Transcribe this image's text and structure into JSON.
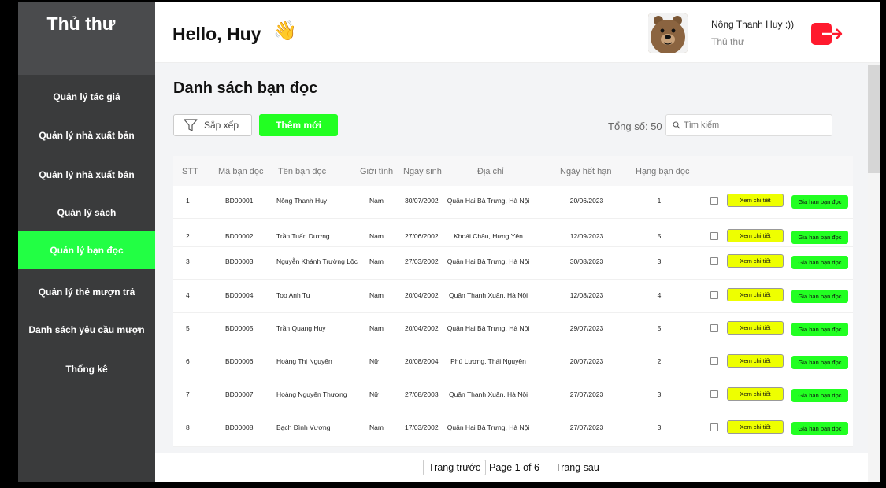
{
  "sidebar": {
    "title": "Thủ thư",
    "items": [
      {
        "label": "Quản lý tác giả",
        "active": false
      },
      {
        "label": "Quản lý nhà xuất bản",
        "active": false
      },
      {
        "label": "Quản lý nhà xuất bản",
        "active": false
      },
      {
        "label": "Quản lý sách",
        "active": false
      },
      {
        "label": "Quản lý bạn đọc",
        "active": true
      },
      {
        "label": "Quản lý thẻ mượn trả",
        "active": false
      },
      {
        "label": "Danh sách yêu cầu mượn",
        "active": false
      },
      {
        "label": "Thống kê",
        "active": false
      }
    ]
  },
  "header": {
    "greeting": "Hello, Huy",
    "wave": "👋",
    "user_name": "Nông Thanh Huy :))",
    "user_role": "Thủ thư"
  },
  "main": {
    "title": "Danh sách bạn đọc",
    "sort_label": "Sắp xếp",
    "add_label": "Thêm mới",
    "total_text": "Tổng số: 50",
    "search_placeholder": "Tìm kiếm"
  },
  "table": {
    "columns": [
      "STT",
      "Mã bạn đọc",
      "Tên bạn đọc",
      "Giới tính",
      "Ngày sinh",
      "Địa chỉ",
      "Ngày hết hạn",
      "Hạng bạn đọc"
    ],
    "view_label": "Xem chi tiết",
    "renew_label": "Gia hạn bạn đọc",
    "rows": [
      [
        "1",
        "BD00001",
        "Nông Thanh Huy",
        "Nam",
        "30/07/2002",
        "Quận Hai Bà Trưng, Hà Nội",
        "20/06/2023",
        "1"
      ],
      [
        "2",
        "BD00002",
        "Trần Tuấn Dương",
        "Nam",
        "27/06/2002",
        "Khoái Châu, Hưng Yên",
        "12/09/2023",
        "5"
      ],
      [
        "3",
        "BD00003",
        "Nguyễn Khánh Trường Lộc",
        "Nam",
        "27/03/2002",
        "Quận Hai Bà Trưng, Hà Nội",
        "30/08/2023",
        "3"
      ],
      [
        "4",
        "BD00004",
        "Too Anh Tu",
        "Nam",
        "20/04/2002",
        "Quận Thanh Xuân, Hà Nội",
        "12/08/2023",
        "4"
      ],
      [
        "5",
        "BD00005",
        "Trần Quang Huy",
        "Nam",
        "20/04/2002",
        "Quận Hai Bà Trưng, Hà Nội",
        "29/07/2023",
        "5"
      ],
      [
        "6",
        "BD00006",
        "Hoàng Thị Nguyên",
        "Nữ",
        "20/08/2004",
        "Phú Lương, Thái Nguyên",
        "20/07/2023",
        "2"
      ],
      [
        "7",
        "BD00007",
        "Hoàng Nguyên Thương",
        "Nữ",
        "27/08/2003",
        "Quận Thanh Xuân, Hà Nội",
        "27/07/2023",
        "3"
      ],
      [
        "8",
        "BD00008",
        "Bạch Đình Vương",
        "Nam",
        "17/03/2002",
        "Quận Hai Bà Trưng, Hà Nội",
        "27/07/2023",
        "3"
      ]
    ]
  },
  "pagination": {
    "prev_label": "Trang trước",
    "info": "Page 1 of 6",
    "next_label": "Trang sau"
  },
  "colors": {
    "sidebar_bg": "#3a3b3c",
    "active_green": "#22ff44",
    "view_button": "#eeff00",
    "logout_red": "#ff1a2e"
  },
  "icons": {
    "sort": "funnel-icon",
    "search": "search-icon",
    "logout": "logout-icon",
    "avatar": "bear-avatar"
  }
}
